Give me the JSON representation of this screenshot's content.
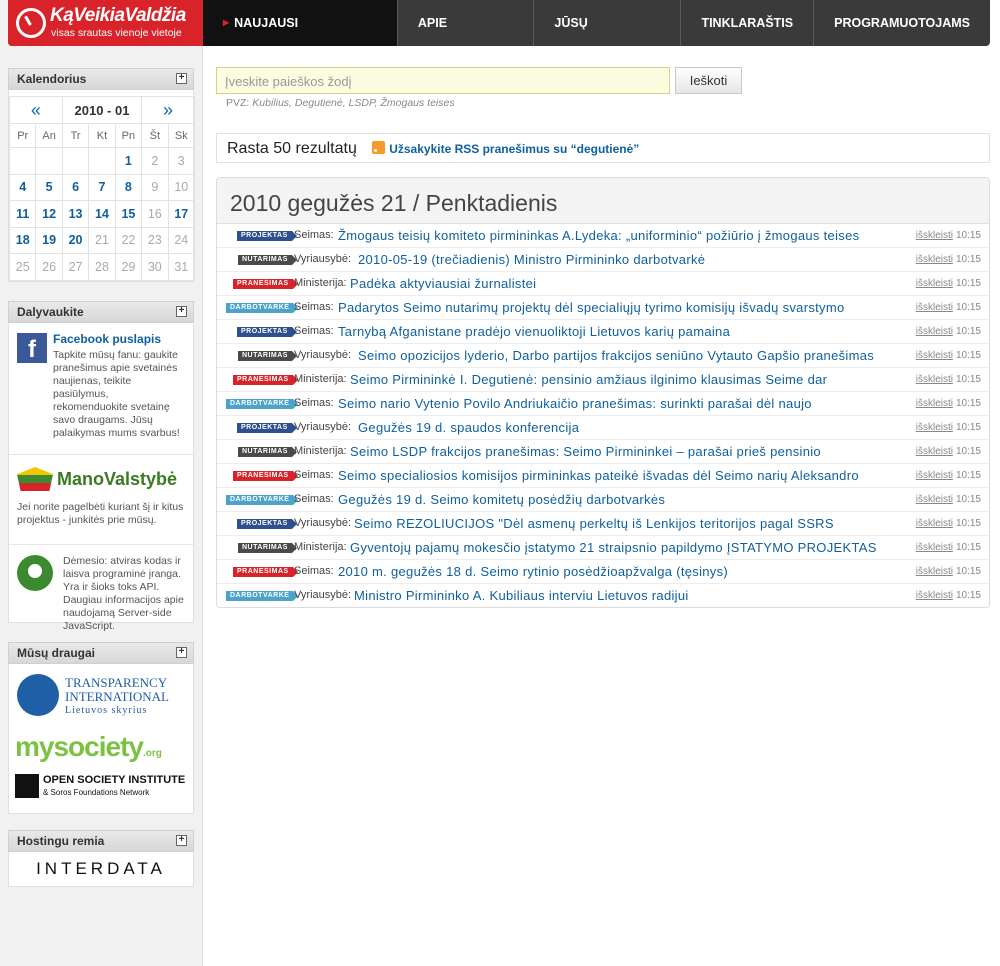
{
  "site": {
    "logo_title": "KąVeikiaValdžia",
    "logo_tagline": "visas srautas vienoje vietoje",
    "nav": [
      "NAUJAUSI DOKUMENTAI",
      "APIE PROJEKTĄ",
      "JŪSŲ PASIŪLYMAI",
      "TINKLARAŠTIS",
      "PROGRAMUOTOJAMS"
    ]
  },
  "calendar": {
    "title": "Kalendorius",
    "month": "2010 - 01",
    "prev": "«",
    "next": "»",
    "days": [
      "Pr",
      "An",
      "Tr",
      "Kt",
      "Pn",
      "Št",
      "Sk"
    ],
    "weeks": [
      [
        "",
        "",
        "",
        "",
        "1",
        "2",
        "3"
      ],
      [
        "4",
        "5",
        "6",
        "7",
        "8",
        "9",
        "10"
      ],
      [
        "11",
        "12",
        "13",
        "14",
        "15",
        "16",
        "17"
      ],
      [
        "18",
        "19",
        "20",
        "21",
        "22",
        "23",
        "24"
      ],
      [
        "25",
        "26",
        "27",
        "28",
        "29",
        "30",
        "31"
      ]
    ],
    "linked": [
      "1",
      "4",
      "5",
      "6",
      "7",
      "8",
      "11",
      "12",
      "13",
      "14",
      "15",
      "17",
      "18",
      "19",
      "20"
    ]
  },
  "participate": {
    "title": "Dalyvaukite",
    "fb_title": "Facebook puslapis",
    "fb_text": "Tapkite mūsų fanu: gaukite pranešimus apie svetainės naujienas, teikite pasiūlymus, rekomenduokite svetainę savo draugams. Jūsų palaikymas mums svarbus!",
    "mv_logo": "ManoValstybė",
    "mv_text": "Jei norite pagelbėti kuriant šį ir kitus projektus - junkitės prie mūsų.",
    "os_text": "Dėmesio: atviras kodas ir laisva programinė įranga. Yra ir šioks toks API. Daugiau informacijos apie naudojamą Server-side JavaScript."
  },
  "friends": {
    "title": "Mūsų draugai",
    "ti_line1": "TRANSPARENCY",
    "ti_line2": "INTERNATIONAL",
    "ti_line3": "Lietuvos skyrius",
    "mysociety": "mysociety",
    "mysociety_suffix": ".org",
    "osi_line1": "OPEN SOCIETY INSTITUTE",
    "osi_line2": "& Soros Foundations Network"
  },
  "hosting": {
    "title": "Hostingu remia",
    "logo": "INTERDATA"
  },
  "search": {
    "placeholder": "Įveskite paieškos žodį",
    "button": "Ieškoti",
    "hint_prefix": "PVZ:",
    "hint_examples": "Kubilius, Degutienė, LSDP, Žmogaus teises"
  },
  "results": {
    "count_text": "Rasta 50 rezultatų",
    "rss_text": "Užsakykite RSS pranešimus su “degutienė”"
  },
  "day": {
    "heading": "2010 gegužės 21 / Penktadienis",
    "expand_label": "išskleisti",
    "items": [
      {
        "badge": "PROJEKTAS",
        "color": "#2f4f8f",
        "source": "Seimas:",
        "title": "Žmogaus teisių komiteto pirmininkas A.Lydeka: „uniforminio“ požiūrio į žmogaus teises",
        "time": "10:15"
      },
      {
        "badge": "NUTARIMAS",
        "color": "#4a4a4a",
        "source": "Vyriausybė:",
        "title": "2010-05-19 (trečiadienis) Ministro Pirmininko darbotvarkė",
        "time": "10:15"
      },
      {
        "badge": "PRANEŠIMAS",
        "color": "#d8232a",
        "source": "Ministerija:",
        "title": "Padėka aktyviausiai žurnalistei",
        "time": "10:15"
      },
      {
        "badge": "DARBOTVARKĖ",
        "color": "#4ba3c7",
        "source": "Seimas:",
        "title": "Padarytos Seimo nutarimų projektų dėl specialiųjų tyrimo komisijų išvadų svarstymo",
        "time": "10:15"
      },
      {
        "badge": "PROJEKTAS",
        "color": "#2f4f8f",
        "source": "Seimas:",
        "title": "Tarnybą Afganistane pradėjo vienuoliktoji Lietuvos karių pamaina",
        "time": "10:15"
      },
      {
        "badge": "NUTARIMAS",
        "color": "#4a4a4a",
        "source": "Vyriausybė:",
        "title": "Seimo opozicijos lyderio, Darbo partijos frakcijos seniūno Vytauto Gapšio pranešimas",
        "time": "10:15"
      },
      {
        "badge": "PRANEŠIMAS",
        "color": "#d8232a",
        "source": "Ministerija:",
        "title": "Seimo Pirmininkė I. Degutienė: pensinio amžiaus ilginimo klausimas Seime dar",
        "time": "10:15"
      },
      {
        "badge": "DARBOTVARKĖ",
        "color": "#4ba3c7",
        "source": "Seimas:",
        "title": "Seimo nario Vytenio Povilo Andriukaičio pranešimas: surinkti parašai dėl naujo",
        "time": "10:15"
      },
      {
        "badge": "PROJEKTAS",
        "color": "#2f4f8f",
        "source": "Vyriausybė:",
        "title": "Gegužės 19 d. spaudos konferencija",
        "time": "10:15"
      },
      {
        "badge": "NUTARIMAS",
        "color": "#4a4a4a",
        "source": "Ministerija:",
        "title": "Seimo LSDP frakcijos pranešimas: Seimo Pirmininkei – parašai prieš pensinio",
        "time": "10:15"
      },
      {
        "badge": "PRANEŠIMAS",
        "color": "#d8232a",
        "source": "Seimas:",
        "title": "Seimo specialiosios komisijos pirmininkas pateikė išvadas dėl Seimo narių Aleksandro",
        "time": "10:15"
      },
      {
        "badge": "DARBOTVARKĖ",
        "color": "#4ba3c7",
        "source": "Seimas:",
        "title": "Gegužės 19 d. Seimo komitetų posėdžių darbotvarkės",
        "time": "10:15"
      },
      {
        "badge": "PROJEKTAS",
        "color": "#2f4f8f",
        "source": "Vyriausybė:",
        "title": "Seimo REZOLIUCIJOS \"Dėl asmenų perkeltų iš Lenkijos teritorijos pagal SSRS",
        "time": "10:15"
      },
      {
        "badge": "NUTARIMAS",
        "color": "#4a4a4a",
        "source": "Ministerija:",
        "title": "Gyventojų pajamų mokesčio įstatymo 21 straipsnio papildymo ĮSTATYMO PROJEKTAS",
        "time": "10:15"
      },
      {
        "badge": "PRANEŠIMAS",
        "color": "#d8232a",
        "source": "Seimas:",
        "title": "2010 m. gegužės 18 d. Seimo rytinio posėdžioapžvalga (tęsinys)",
        "time": "10:15"
      },
      {
        "badge": "DARBOTVARKĖ",
        "color": "#4ba3c7",
        "source": "Vyriausybė:",
        "title": "Ministro Pirmininko A. Kubiliaus interviu Lietuvos radijui",
        "time": "10:15"
      }
    ]
  }
}
